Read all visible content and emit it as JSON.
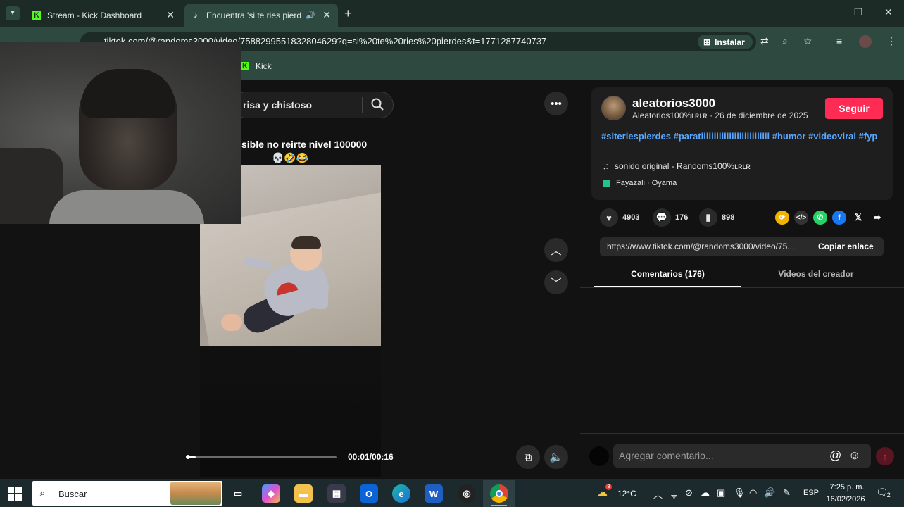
{
  "browser": {
    "tabs": [
      {
        "title": "Stream - Kick Dashboard",
        "icon": "kick-icon"
      },
      {
        "title": "Encuentra 'si te ries pierdes",
        "icon": "tiktok-icon",
        "active": true
      }
    ],
    "url": "tiktok.com/@randoms3000/video/7588299551832804629?q=si%20te%20ries%20pierdes&t=1771287740737",
    "install_label": "Instalar",
    "bookmark": "Kick"
  },
  "search": {
    "query": "risa y chistoso"
  },
  "video": {
    "caption_line1": "sible no reirte nivel 100000",
    "caption_line2": "💀🤣😂",
    "timecode": "00:01/00:16",
    "progress": 0.06
  },
  "creator": {
    "username": "aleatorios3000",
    "subline": "Aleatorios100%ʟʀʟʀ · 26 de diciembre de 2025",
    "follow_label": "Seguir",
    "hashtags": "#siteriespierdes #paratiiiiiiiiiiiiiiiiiiiiiiiiiii #humor #videoviral #fyp",
    "sound": "sonido original - Randoms100%ʟʀʟʀ",
    "location": "Fayazali · Oyama"
  },
  "stats": {
    "likes": "4903",
    "comments": "176",
    "saves": "898"
  },
  "link": {
    "url": "https://www.tiktok.com/@randoms3000/video/75...",
    "copy_label": "Copiar enlace"
  },
  "tabs": {
    "comments": "Comentarios (176)",
    "videos": "Videos del creador"
  },
  "comment_box": {
    "placeholder": "Agregar comentario..."
  },
  "taskbar": {
    "search_label": "Buscar",
    "weather_badge": "3",
    "temperature": "12°C",
    "language": "ESP",
    "time": "7:25 p. m.",
    "date": "16/02/2026",
    "notification_count": "2"
  },
  "colors": {
    "accent_follow": "#fe2c55",
    "hashtag": "#5aa9ff",
    "browser_frame": "#2e4a40"
  }
}
